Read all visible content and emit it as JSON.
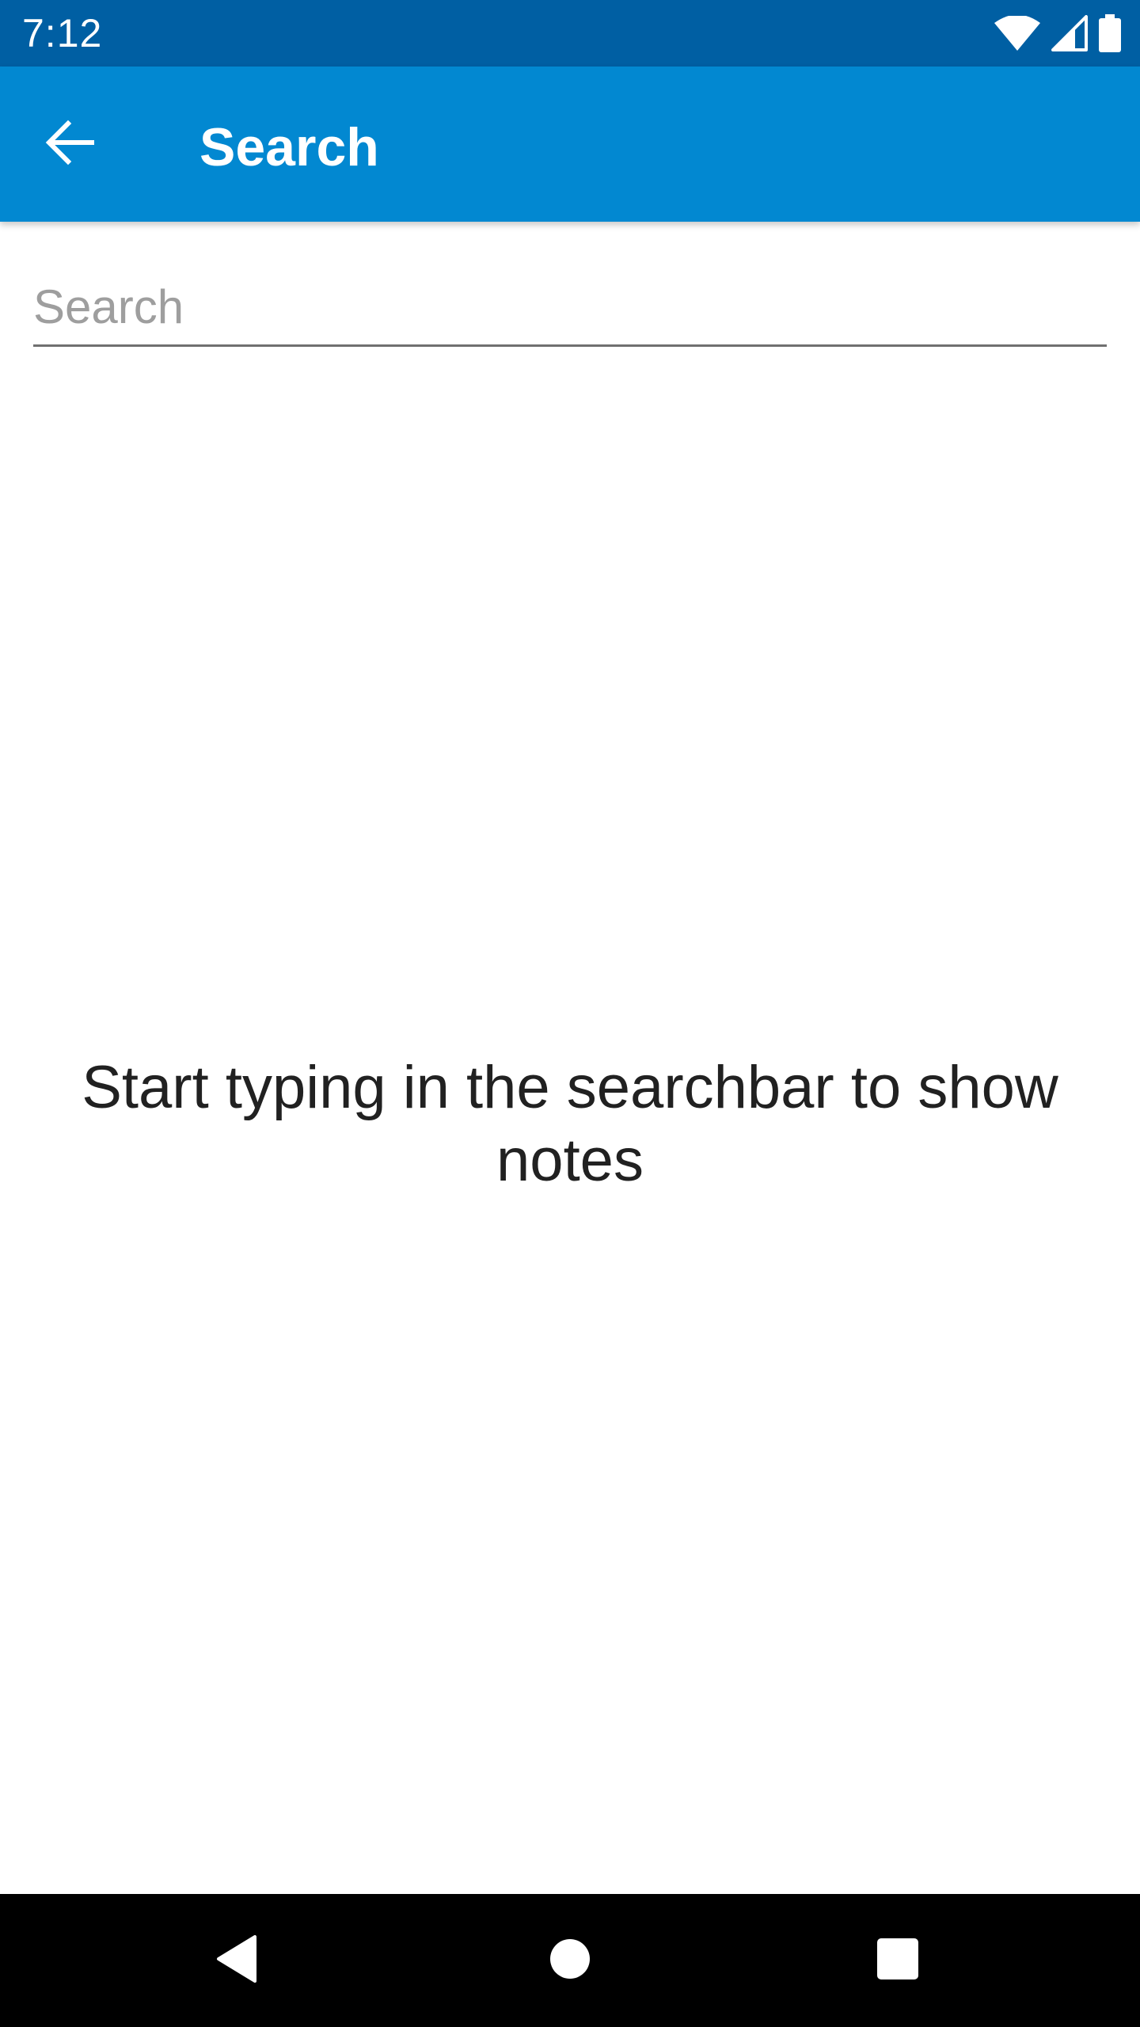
{
  "status_bar": {
    "time": "7:12",
    "icons": [
      "wifi-icon",
      "cellular-signal-icon",
      "battery-icon"
    ]
  },
  "app_bar": {
    "title": "Search",
    "back_icon": "arrow-back-icon",
    "color": "#0288d1"
  },
  "search": {
    "placeholder": "Search",
    "value": ""
  },
  "empty_state": {
    "message": "Start typing in the searchbar to show notes"
  },
  "nav_bar": {
    "buttons": [
      "back-triangle-icon",
      "home-circle-icon",
      "recents-square-icon"
    ]
  },
  "colors": {
    "status_bar": "#005fa3",
    "app_bar": "#0288d1",
    "background": "#ffffff",
    "nav_bar": "#000000"
  }
}
